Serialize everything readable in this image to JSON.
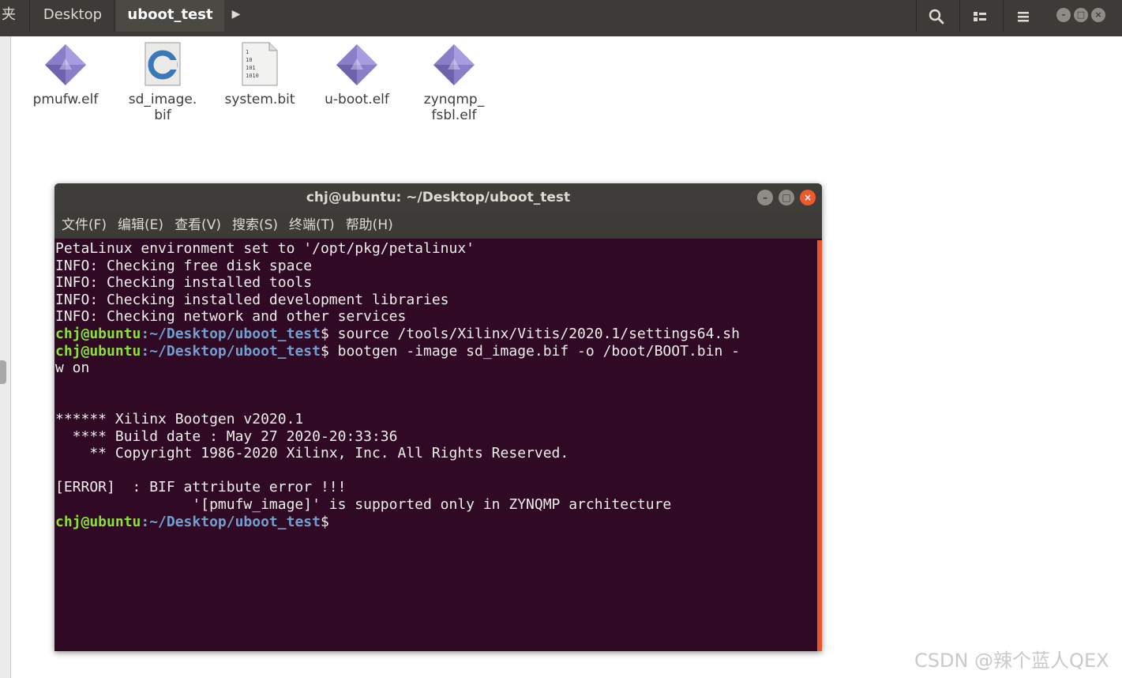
{
  "file_manager": {
    "breadcrumbs": [
      "夹",
      "Desktop",
      "uboot_test"
    ],
    "current_folder": "uboot_test",
    "files": [
      {
        "name": "pmufw.elf",
        "icon": "elf-binary-icon"
      },
      {
        "name": "sd_image.\nbif",
        "icon": "c-source-file-icon"
      },
      {
        "name": "system.bit",
        "icon": "binary-file-icon"
      },
      {
        "name": "u-boot.elf",
        "icon": "elf-binary-icon"
      },
      {
        "name": "zynqmp_\nfsbl.elf",
        "icon": "elf-binary-icon"
      }
    ]
  },
  "terminal": {
    "title": "chj@ubuntu: ~/Desktop/uboot_test",
    "menu": [
      "文件(F)",
      "编辑(E)",
      "查看(V)",
      "搜索(S)",
      "终端(T)",
      "帮助(H)"
    ],
    "prompt_user": "chj@ubuntu",
    "prompt_path": ":~/Desktop/uboot_test",
    "lines": [
      {
        "type": "out",
        "text": "PetaLinux environment set to '/opt/pkg/petalinux'"
      },
      {
        "type": "out",
        "text": "INFO: Checking free disk space"
      },
      {
        "type": "out",
        "text": "INFO: Checking installed tools"
      },
      {
        "type": "out",
        "text": "INFO: Checking installed development libraries"
      },
      {
        "type": "out",
        "text": "INFO: Checking network and other services"
      },
      {
        "type": "cmd",
        "text": "$ source /tools/Xilinx/Vitis/2020.1/settings64.sh"
      },
      {
        "type": "cmd",
        "text": "$ bootgen -image sd_image.bif -o /boot/BOOT.bin -"
      },
      {
        "type": "out",
        "text": "w on"
      },
      {
        "type": "out",
        "text": ""
      },
      {
        "type": "out",
        "text": ""
      },
      {
        "type": "out",
        "text": "****** Xilinx Bootgen v2020.1"
      },
      {
        "type": "out",
        "text": "  **** Build date : May 27 2020-20:33:36"
      },
      {
        "type": "out",
        "text": "    ** Copyright 1986-2020 Xilinx, Inc. All Rights Reserved."
      },
      {
        "type": "out",
        "text": ""
      },
      {
        "type": "out",
        "text": "[ERROR]  : BIF attribute error !!!"
      },
      {
        "type": "out",
        "text": "                '[pmufw_image]' is supported only in ZYNQMP architecture"
      },
      {
        "type": "cmd",
        "text": "$ "
      }
    ]
  },
  "watermark": "CSDN @辣个蓝人QEX"
}
